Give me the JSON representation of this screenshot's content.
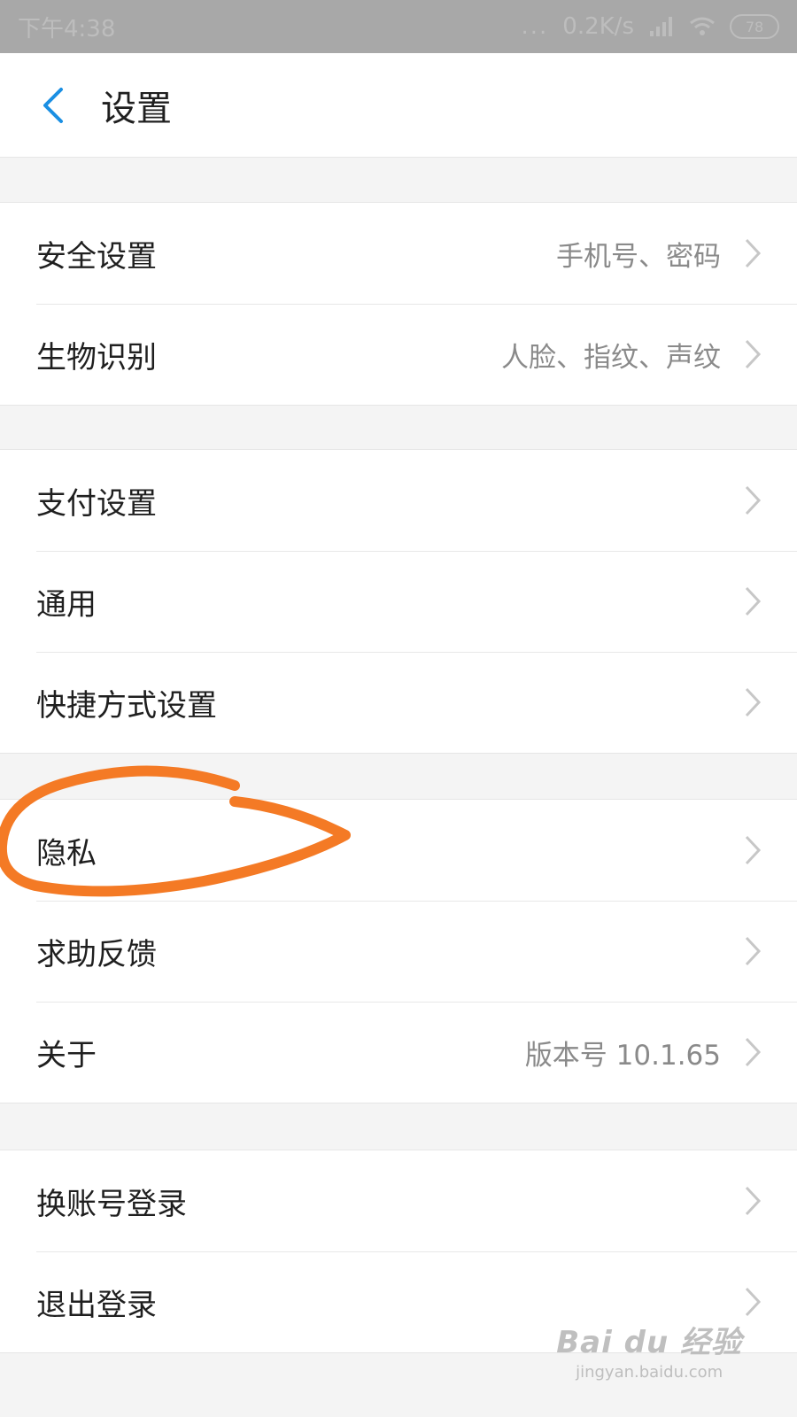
{
  "status_bar": {
    "time": "下午4:38",
    "dots": "...",
    "network_speed": "0.2K/s",
    "battery": "78"
  },
  "header": {
    "title": "设置",
    "back_icon": "chevron-left-icon",
    "accent_color": "#1a8fe3"
  },
  "groups": [
    {
      "items": [
        {
          "label": "安全设置",
          "value": "手机号、密码"
        },
        {
          "label": "生物识别",
          "value": "人脸、指纹、声纹"
        }
      ]
    },
    {
      "items": [
        {
          "label": "支付设置",
          "value": ""
        },
        {
          "label": "通用",
          "value": ""
        },
        {
          "label": "快捷方式设置",
          "value": ""
        }
      ]
    },
    {
      "items": [
        {
          "label": "隐私",
          "value": ""
        },
        {
          "label": "求助反馈",
          "value": ""
        },
        {
          "label": "关于",
          "value": "版本号 10.1.65"
        }
      ]
    },
    {
      "items": [
        {
          "label": "换账号登录",
          "value": ""
        },
        {
          "label": "退出登录",
          "value": ""
        }
      ]
    }
  ],
  "annotation": {
    "color": "#f47a25",
    "icon": "circle-highlight"
  },
  "watermark": {
    "main": "Bai du 经验",
    "sub": "jingyan.baidu.com"
  }
}
